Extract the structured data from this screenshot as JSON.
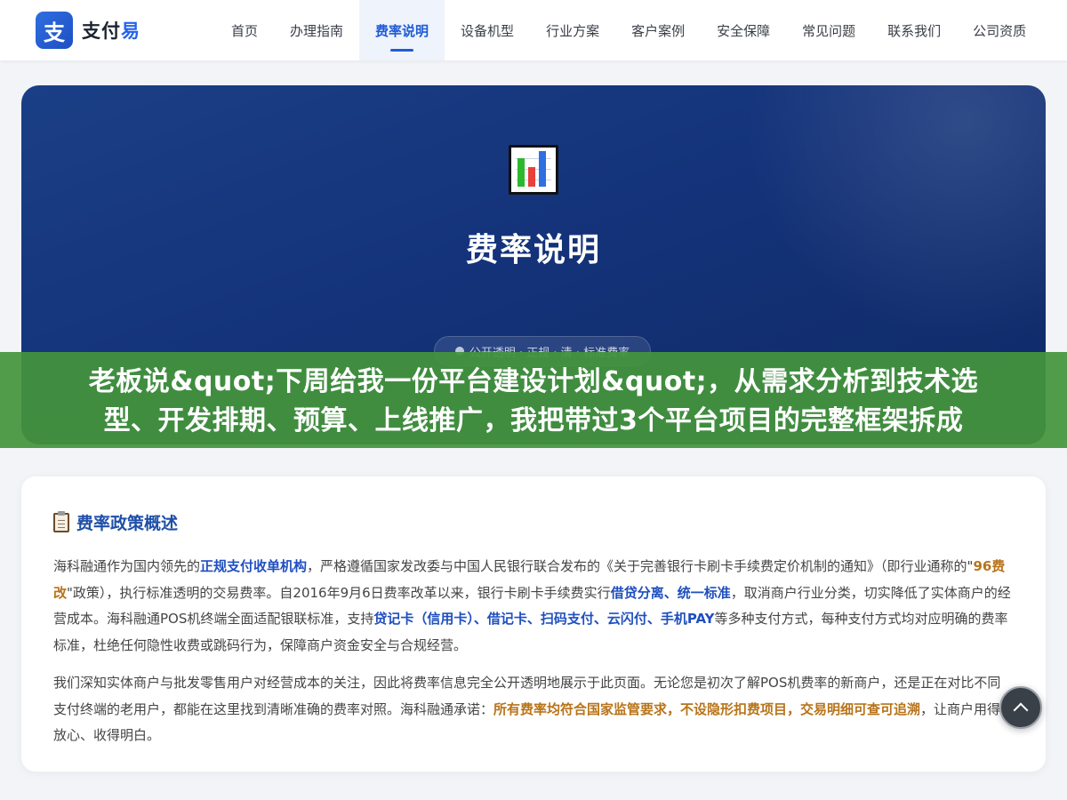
{
  "brand": {
    "logo_char": "支",
    "name_main": "支付",
    "name_accent": "易"
  },
  "nav": {
    "items": [
      {
        "label": "首页"
      },
      {
        "label": "办理指南"
      },
      {
        "label": "费率说明",
        "active": true
      },
      {
        "label": "设备机型"
      },
      {
        "label": "行业方案"
      },
      {
        "label": "客户案例"
      },
      {
        "label": "安全保障"
      },
      {
        "label": "常见问题"
      },
      {
        "label": "联系我们"
      },
      {
        "label": "公司资质"
      }
    ]
  },
  "hero": {
    "icon": "bar-chart-icon",
    "title": "费率说明",
    "badge": "公开透明 · 正规 · 清 · 标准费率"
  },
  "banner": {
    "line1": "老板说&quot;下周给我一份平台建设计划&quot;，从需求分析到技术选",
    "line2": "型、开发排期、预算、上线推广，我把带过3个平台项目的完整框架拆成"
  },
  "card": {
    "icon": "clipboard-icon",
    "title": "费率政策概述",
    "p1": {
      "t1": "海科融通作为国内领先的",
      "b1": "正规支付收单机构",
      "t2": "，严格遵循国家发改委与中国人民银行联合发布的《关于完善银行卡刷卡手续费定价机制的通知》（即行业通称的\"",
      "g1": "96费改",
      "t3": "\"政策），执行标准透明的交易费率。自2016年9月6日费率改革以来，银行卡刷卡手续费实行",
      "b2": "借贷分离、统一标准",
      "t4": "，取消商户行业分类，切实降低了实体商户的经营成本。海科融通POS机终端全面适配银联标准，支持",
      "b3": "贷记卡（信用卡）、借记卡、扫码支付、云闪付、手机PAY",
      "t5": "等多种支付方式，每种支付方式均对应明确的费率标准，杜绝任何隐性收费或跳码行为，保障商户资金安全与合规经营。"
    },
    "p2": {
      "t1": "我们深知实体商户与批发零售用户对经营成本的关注，因此将费率信息完全公开透明地展示于此页面。无论您是初次了解POS机费率的新商户，还是正在对比不同支付终端的老用户，都能在这里找到清晰准确的费率对照。海科融通承诺：",
      "g1": "所有费率均符合国家监管要求，不设隐形扣费项目，交易明细可查可追溯",
      "t2": "，让商户用得放心、收得明白。"
    }
  },
  "back_to_top": {
    "icon": "chevron-up-icon"
  }
}
